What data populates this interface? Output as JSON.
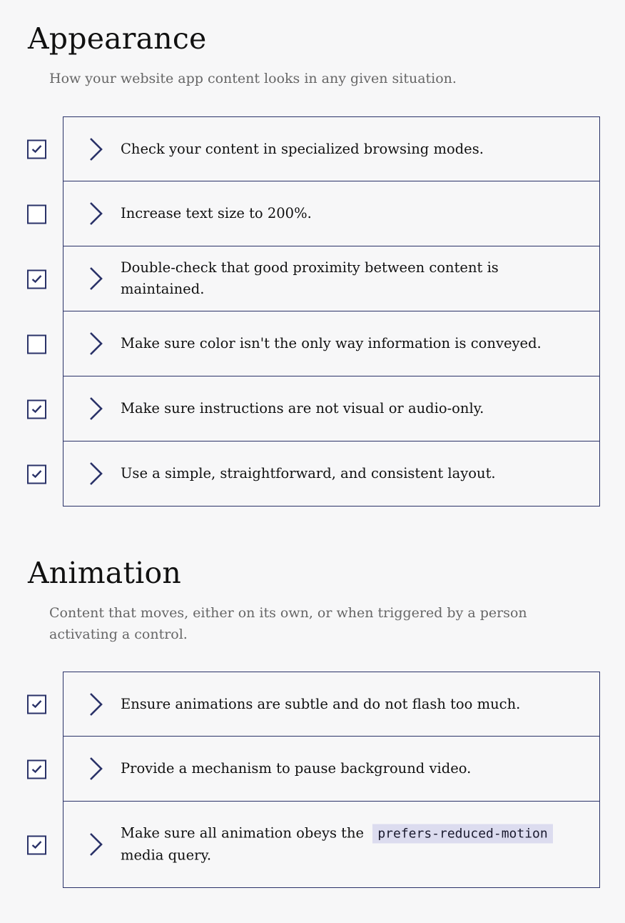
{
  "appearance": {
    "title": "Appearance",
    "description": "How your website app content looks in any given situation.",
    "items": [
      {
        "label": "Check your content in specialized browsing modes.",
        "checked": true
      },
      {
        "label": "Increase text size to 200%.",
        "checked": false
      },
      {
        "label": "Double-check that good proximity between content is maintained.",
        "checked": true
      },
      {
        "label": "Make sure color isn't the only way information is conveyed.",
        "checked": false
      },
      {
        "label": "Make sure instructions are not visual or audio-only.",
        "checked": true
      },
      {
        "label": "Use a simple, straightforward, and consistent layout.",
        "checked": true
      }
    ]
  },
  "animation": {
    "title": "Animation",
    "description": "Content that moves, either on its own, or when triggered by a person activating a control.",
    "items": [
      {
        "label": "Ensure animations are subtle and do not flash too much.",
        "checked": true
      },
      {
        "label": "Provide a mechanism to pause background video.",
        "checked": true
      },
      {
        "label_before": "Make sure all animation obeys the",
        "code": "prefers-reduced-motion",
        "label_after": "media query.",
        "checked": true
      }
    ]
  },
  "colors": {
    "accent": "#2a3268",
    "code_bg": "#dcdcef",
    "muted": "#666666"
  },
  "icons": {
    "checkbox_mark": "checkmark-icon",
    "expand": "chevron-right-icon"
  }
}
